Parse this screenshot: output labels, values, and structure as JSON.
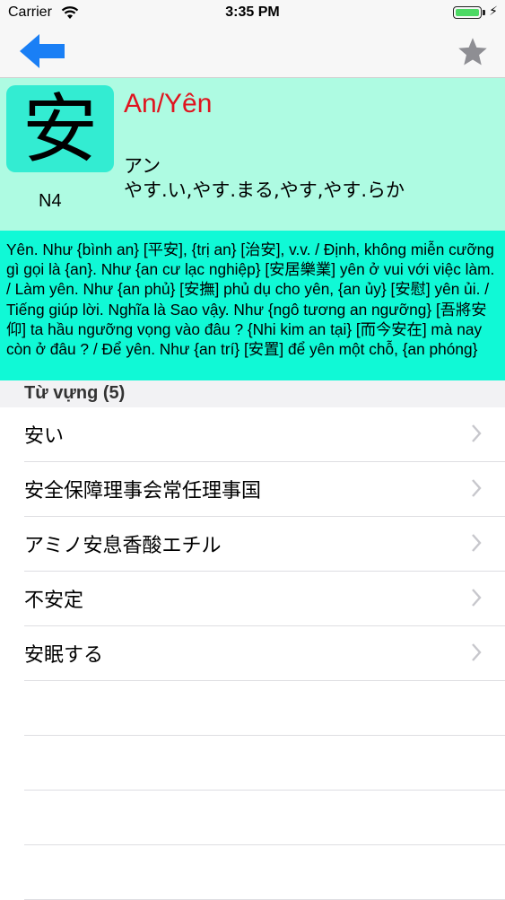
{
  "status_bar": {
    "carrier": "Carrier",
    "time": "3:35 PM"
  },
  "nav": {
    "back_icon": "left-arrow-icon",
    "favorite_icon": "star-icon"
  },
  "kanji": {
    "character": "安",
    "jlpt_level": "N4",
    "hanviet": "An/Yên",
    "onyomi": "アン",
    "kunyomi": "やす.い,やす.まる,やす,やす.らか"
  },
  "meaning": "Yên. Như {bình an} [平安], {trị an} [治安], v.v. / Định, không miễn cưỡng gì gọi là {an}. Như {an cư lạc nghiệp} [安居樂業] yên ở vui với việc làm. / Làm yên. Như {an phủ} [安撫] phủ dụ cho yên, {an ủy} [安慰] yên ủi. / Tiếng giúp lời. Nghĩa là Sao vậy. Như {ngô tương an ngưỡng} [吾將安仰] ta hầu ngưỡng vọng vào đâu ? {Nhi kim an tại} [而今安在] mà nay còn ở đâu ? / Để yên. Như {an trí} [安置] để yên một chỗ, {an phóng}",
  "vocab": {
    "header": "Từ vựng (5)",
    "items": [
      {
        "label": "安い"
      },
      {
        "label": "安全保障理事会常任理事国"
      },
      {
        "label": "アミノ安息香酸エチル"
      },
      {
        "label": "不安定"
      },
      {
        "label": "安眠する"
      }
    ]
  },
  "colors": {
    "back_arrow": "#1a7ff5",
    "star": "#8e8e93",
    "hanviet": "#e0141e",
    "header_bg": "#aefbe2",
    "kanji_box": "#33ecd2",
    "meaning_bg": "#10f9d6"
  }
}
